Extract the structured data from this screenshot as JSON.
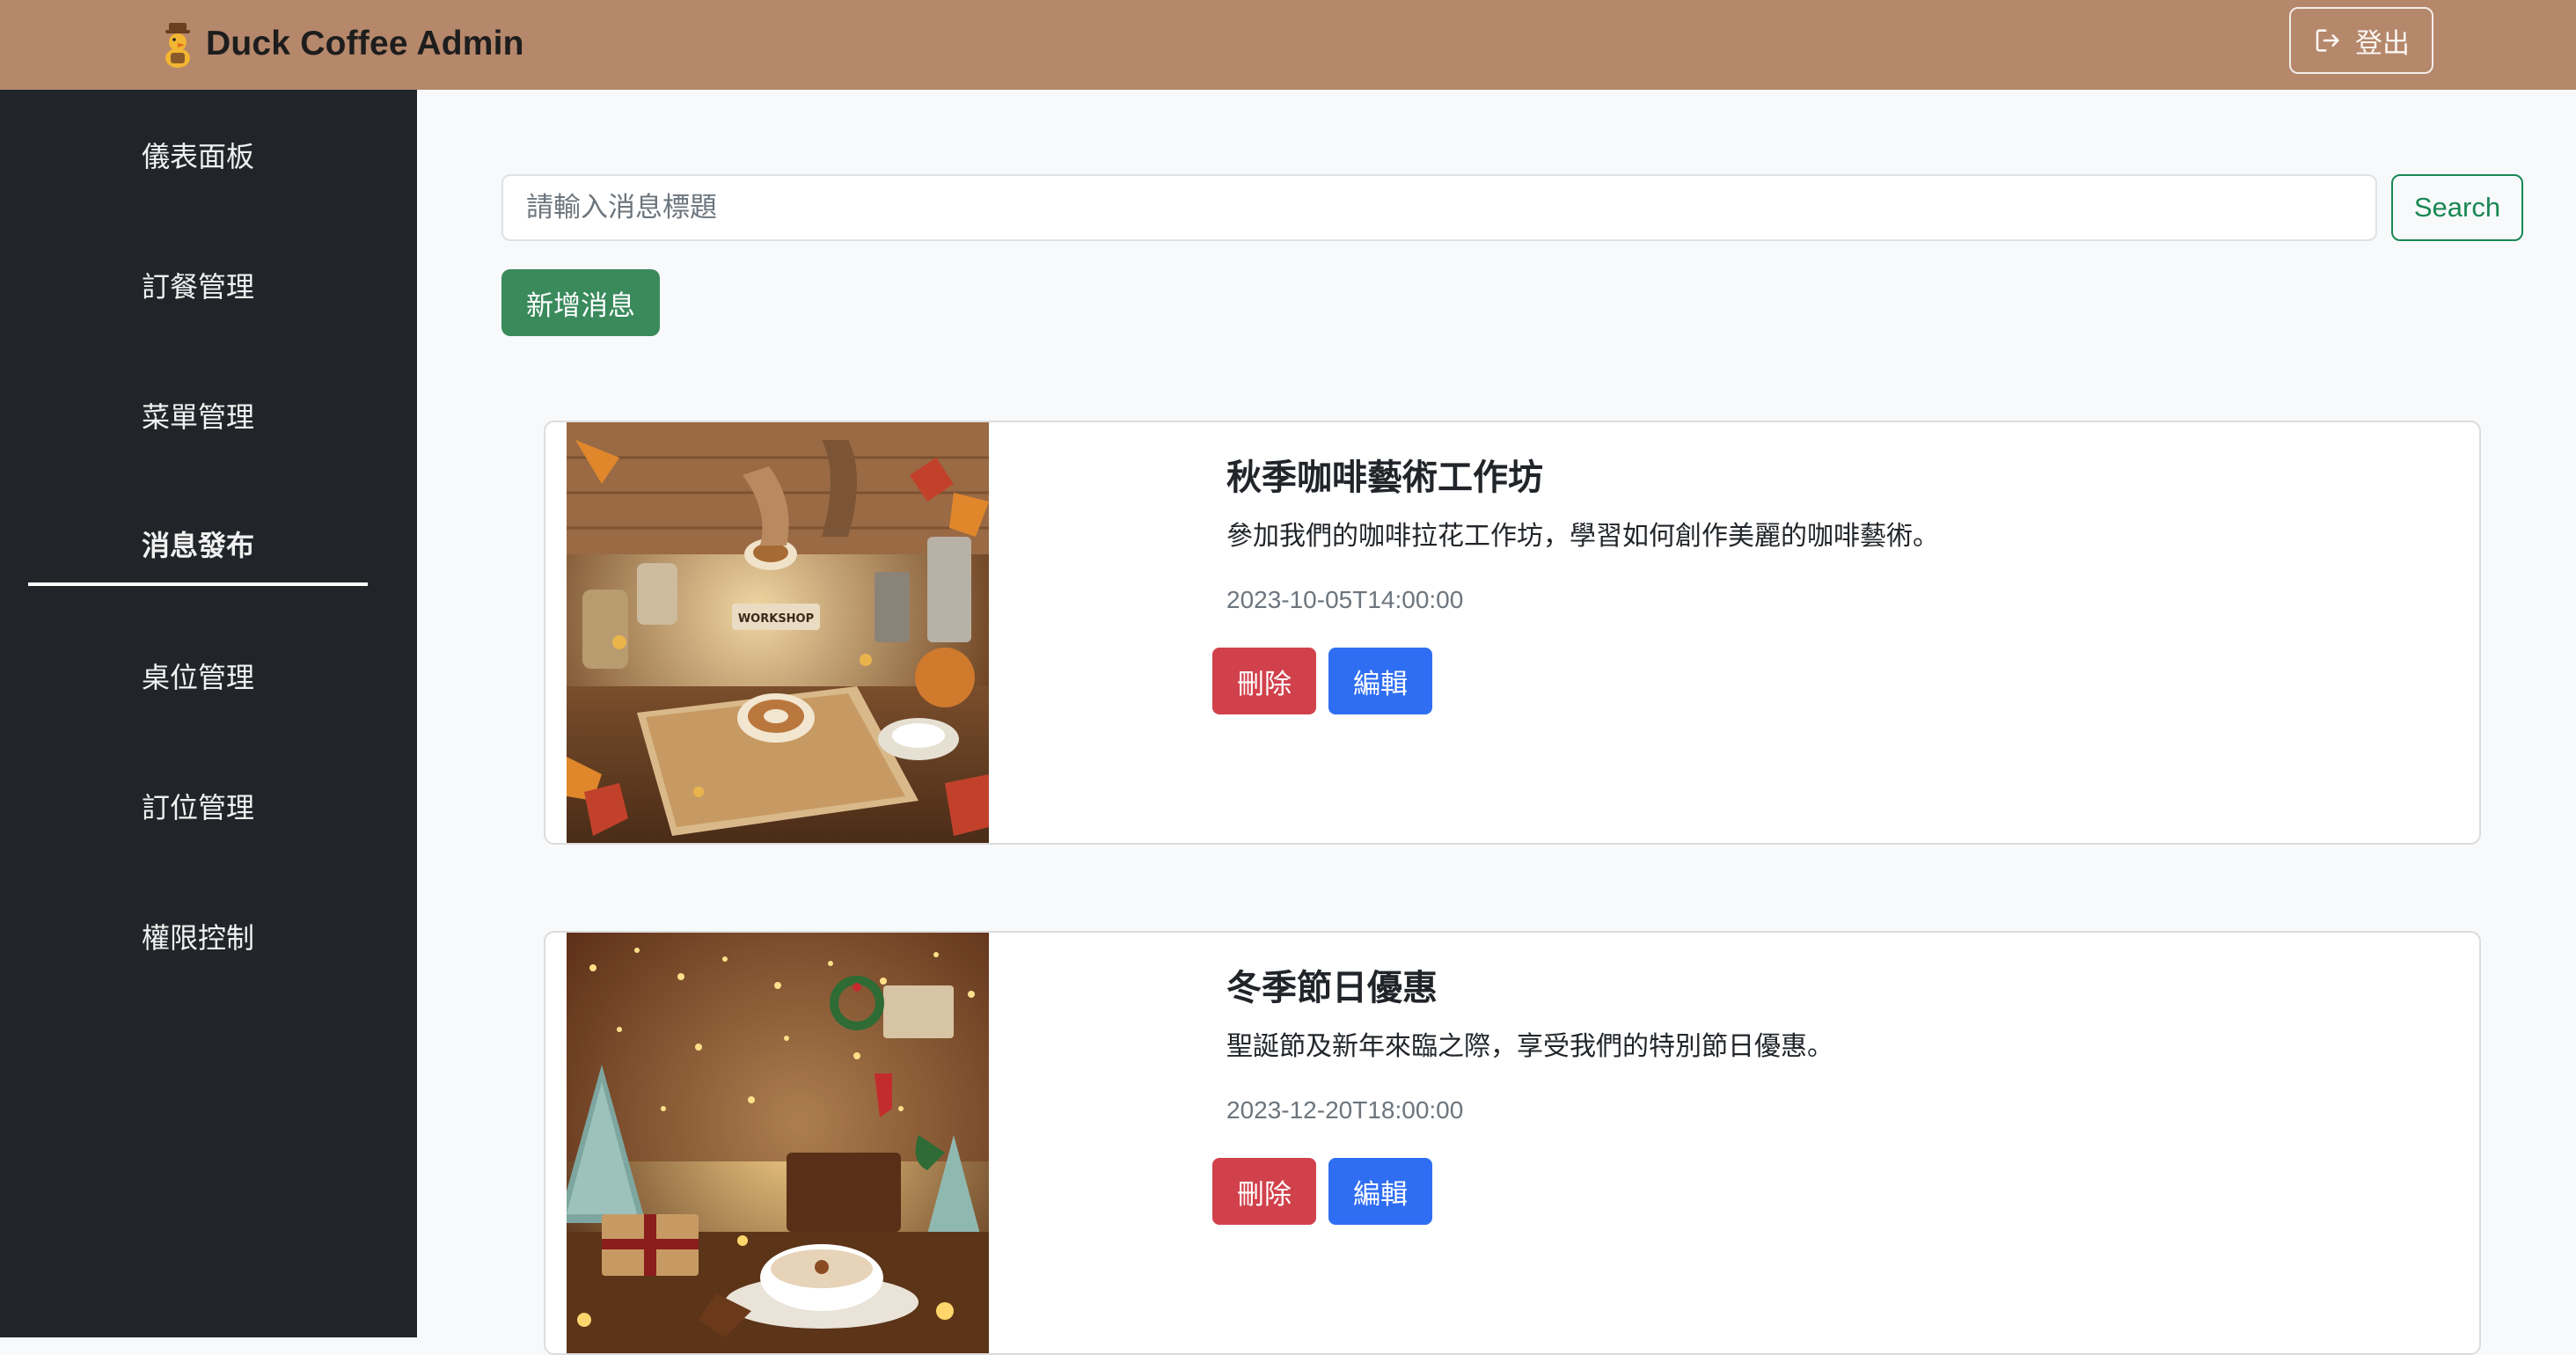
{
  "header": {
    "logo_icon": "duck-mascot-icon",
    "title": "Duck Coffee Admin",
    "logout_label": "登出",
    "logout_icon": "logout-icon",
    "background_color": "#b5876b"
  },
  "sidebar": {
    "background_color": "#212529",
    "items": [
      {
        "label": "儀表面板",
        "active": false
      },
      {
        "label": "訂餐管理",
        "active": false
      },
      {
        "label": "菜單管理",
        "active": false
      },
      {
        "label": "消息發布",
        "active": true
      },
      {
        "label": "桌位管理",
        "active": false
      },
      {
        "label": "訂位管理",
        "active": false
      },
      {
        "label": "權限控制",
        "active": false
      }
    ]
  },
  "search": {
    "placeholder": "請輸入消息標題",
    "value": "",
    "button_label": "Search"
  },
  "actions": {
    "add_label": "新增消息"
  },
  "news": [
    {
      "image_alt": "autumn coffee workshop illustration",
      "title": "秋季咖啡藝術工作坊",
      "description": "參加我們的咖啡拉花工作坊，學習如何創作美麗的咖啡藝術。",
      "datetime": "2023-10-05T14:00:00",
      "delete_label": "刪除",
      "edit_label": "編輯"
    },
    {
      "image_alt": "winter holiday cafe illustration",
      "title": "冬季節日優惠",
      "description": "聖誕節及新年來臨之際，享受我們的特別節日優惠。",
      "datetime": "2023-12-20T18:00:00",
      "delete_label": "刪除",
      "edit_label": "編輯"
    }
  ],
  "colors": {
    "danger": "#d1414c",
    "primary": "#2f6ef2",
    "success": "#3a8a5c"
  }
}
